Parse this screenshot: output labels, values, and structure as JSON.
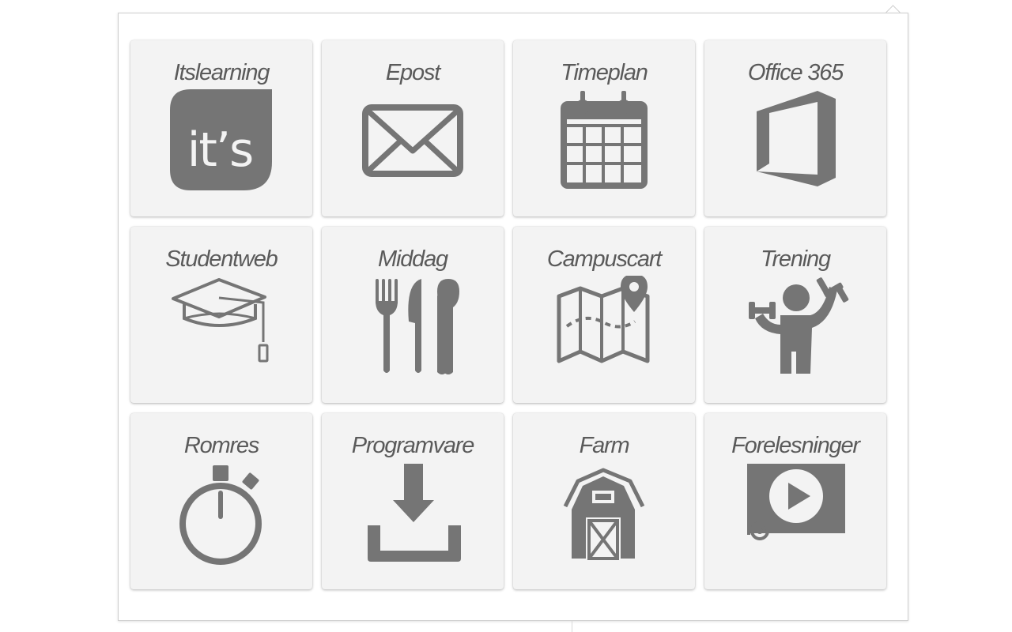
{
  "launcher": {
    "tiles": [
      {
        "label": "Itslearning",
        "icon": "itslearning-logo-icon",
        "logo_text": "it’s"
      },
      {
        "label": "Epost",
        "icon": "envelope-icon"
      },
      {
        "label": "Timeplan",
        "icon": "calendar-icon"
      },
      {
        "label": "Office 365",
        "icon": "office-365-logo-icon"
      },
      {
        "label": "Studentweb",
        "icon": "graduation-cap-icon"
      },
      {
        "label": "Middag",
        "icon": "cutlery-icon"
      },
      {
        "label": "Campuscart",
        "icon": "map-pin-icon"
      },
      {
        "label": "Trening",
        "icon": "dumbbell-workout-icon"
      },
      {
        "label": "Romres",
        "icon": "stopwatch-icon"
      },
      {
        "label": "Programvare",
        "icon": "download-icon"
      },
      {
        "label": "Farm",
        "icon": "barn-icon"
      },
      {
        "label": "Forelesninger",
        "icon": "video-player-icon"
      }
    ]
  },
  "colors": {
    "tile_background": "#f3f3f3",
    "icon": "#757575",
    "label": "#5a5a5a"
  }
}
